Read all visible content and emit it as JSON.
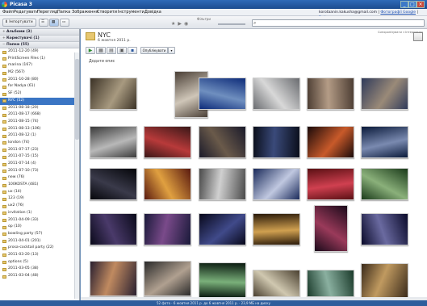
{
  "window": {
    "title": "Picasa 3",
    "minimize": "_",
    "maximize": "□",
    "close": "×"
  },
  "menu": {
    "items": [
      "Файл",
      "Редагувати",
      "Перегляд",
      "Папка",
      "Зображення",
      "Створити",
      "Інструменти",
      "Довідка"
    ],
    "account": "korotaanin.kakusha@gmail.com",
    "separator": "|",
    "link1": "Фотографії Google",
    "link2": "Вийти"
  },
  "toolbar": {
    "import_label": "Імпортувати",
    "filters_label": "Фільтри"
  },
  "sidebar": {
    "sections": [
      {
        "label": "Альбоми (3)",
        "toggle": "+"
      },
      {
        "label": "Користувачі (1)",
        "toggle": "+"
      },
      {
        "label": "Папки (55)",
        "toggle": "−"
      }
    ],
    "folders": [
      {
        "label": "2011-12-20 (49)"
      },
      {
        "label": "PrintScreen Files (1)"
      },
      {
        "label": "marina (167)"
      },
      {
        "label": "M2 (567)"
      },
      {
        "label": "2011-10-28 (80)"
      },
      {
        "label": "for Nadya (61)"
      },
      {
        "label": "SF (52)"
      },
      {
        "label": "NYC (52)",
        "selected": true
      },
      {
        "label": "2011-08-18 (20)"
      },
      {
        "label": "2011-08-17 (668)"
      },
      {
        "label": "2011-08-15 (74)"
      },
      {
        "label": "2011-08-13 (106)"
      },
      {
        "label": "2011-08-12 (1)"
      },
      {
        "label": "london (74)"
      },
      {
        "label": "2011-07-17 (23)"
      },
      {
        "label": "2011-07-15 (15)"
      },
      {
        "label": "2011-07-14 (4)"
      },
      {
        "label": "2011-07-10 (73)"
      },
      {
        "label": "new (76)"
      },
      {
        "label": "100KOSTA (481)"
      },
      {
        "label": "ux (14)"
      },
      {
        "label": "123 (19)"
      },
      {
        "label": "ux2 (76)"
      },
      {
        "label": "invitation (1)"
      },
      {
        "label": "2011-04-09 (33)"
      },
      {
        "label": "op (10)"
      },
      {
        "label": "bowling party (57)"
      },
      {
        "label": "2011-04-01 (201)"
      },
      {
        "label": "prosa-cocktail party (22)"
      },
      {
        "label": "2011-03-20 (13)"
      },
      {
        "label": "options (5)"
      },
      {
        "label": "2011-03-05 (38)"
      },
      {
        "label": "2011-03-04 (48)"
      }
    ]
  },
  "album": {
    "name": "NYC",
    "date": "6 жовтня 2011 р.",
    "sync_label": "Синхронізувати з Інтернетом",
    "add_description": "Додати опис",
    "share_label": "Опублікувати",
    "buttons": [
      {
        "icon": "play-icon",
        "glyph": "▶",
        "color": "#2a8a2a"
      },
      {
        "icon": "collage-icon",
        "glyph": "▦",
        "color": "#555"
      },
      {
        "icon": "movie-icon",
        "glyph": "▤",
        "color": "#555"
      },
      {
        "icon": "web-album-icon",
        "glyph": "▣",
        "color": "#555"
      },
      {
        "icon": "save-icon",
        "glyph": "▪",
        "color": "#2c5aa0"
      }
    ]
  },
  "photos_visual": {
    "colors": [
      [
        "#3b3226",
        "#a89a80"
      ],
      [
        "#4a3f36",
        "#cfc6b8"
      ],
      [
        "#0e2c7a",
        "#6f8fbf"
      ],
      [
        "#6a6c70",
        "#d8d8d8"
      ],
      [
        "#4c3d33",
        "#b49c86"
      ],
      [
        "#2f3a5a",
        "#9a8a78"
      ],
      [
        "#3a3a3a",
        "#b8b8b8"
      ],
      [
        "#3a1818",
        "#b83a3a"
      ],
      [
        "#1a1a2a",
        "#6a5a4a"
      ],
      [
        "#0a0e1a",
        "#3a4a7a"
      ],
      [
        "#1a0a0a",
        "#c85a2a"
      ],
      [
        "#0a1a3a",
        "#7a8ab0"
      ],
      [
        "#05060a",
        "#3a3a4a"
      ],
      [
        "#5a1a10",
        "#e0a040"
      ],
      [
        "#4a4a4a",
        "#d0d0d0"
      ],
      [
        "#1a2a5a",
        "#c0c8e0"
      ],
      [
        "#5a1014",
        "#d04050"
      ],
      [
        "#1a3a1a",
        "#8ab07a"
      ],
      [
        "#0a0a1a",
        "#4a3a6a"
      ],
      [
        "#1a1a3a",
        "#7a4a8a"
      ],
      [
        "#08081a",
        "#404a8a"
      ],
      [
        "#2a1a0a",
        "#d0a050"
      ],
      [
        "#1a0a1a",
        "#9a3a5a"
      ],
      [
        "#0a0a2a",
        "#6a6aa0"
      ],
      [
        "#2a2030",
        "#c08a60"
      ],
      [
        "#2a2a2a",
        "#b0a090"
      ],
      [
        "#0a1a10",
        "#7ab07a"
      ],
      [
        "#4a4030",
        "#d0c8b0"
      ],
      [
        "#1a3a2a",
        "#8ab0a0"
      ],
      [
        "#3a2a1a",
        "#c09a60"
      ]
    ]
  },
  "status": {
    "text": "52 фото · 6 жовтня 2011 р. до 6 жовтня 2011 р. · 23,9 МБ на диску"
  }
}
